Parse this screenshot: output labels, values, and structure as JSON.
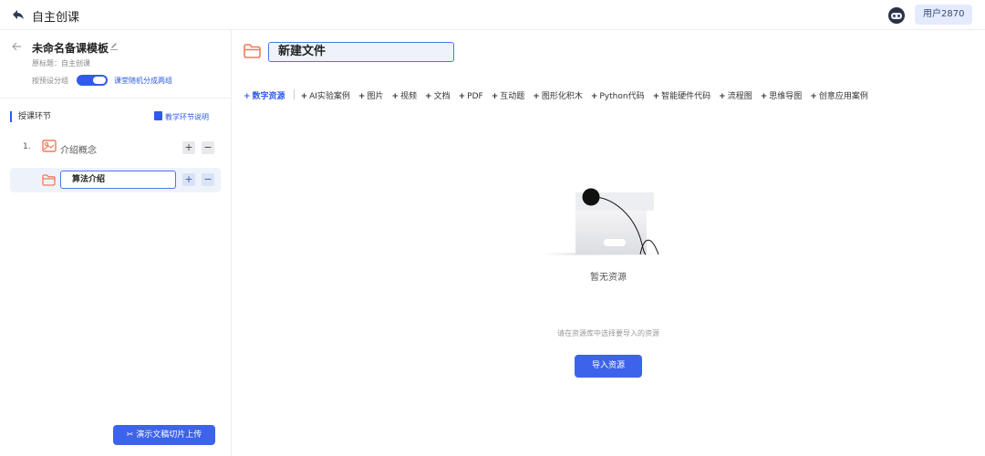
{
  "header": {
    "app_title": "自主创课",
    "user_label": "用户2870"
  },
  "sidebar": {
    "template_name": "未命名备课模板",
    "original_title": "原标题：自主创课",
    "group_label": "按预设分组",
    "group_mode": "课堂随机分成两组",
    "section_title": "授课环节",
    "section_help": "教学环节说明",
    "lessons": [
      {
        "number": "1.",
        "label": "介绍概念"
      }
    ],
    "editing_lesson_value": "算法介绍",
    "upload_button": "演示文稿切片上传"
  },
  "main": {
    "file_title": "新建文件",
    "tabs": [
      {
        "label": "数字资源",
        "active": true
      },
      {
        "label": "AI实验案例"
      },
      {
        "label": "图片"
      },
      {
        "label": "视频"
      },
      {
        "label": "文档"
      },
      {
        "label": "PDF"
      },
      {
        "label": "互动题"
      },
      {
        "label": "图形化积木"
      },
      {
        "label": "Python代码"
      },
      {
        "label": "智能硬件代码"
      },
      {
        "label": "流程图"
      },
      {
        "label": "思维导图"
      },
      {
        "label": "创意应用案例"
      }
    ],
    "tab_plus": "+",
    "empty_title": "暂无资源",
    "hint": "请在资源库中选择要导入的资源",
    "import_button": "导入资源"
  },
  "buttons": {
    "plus": "+",
    "minus": "−"
  },
  "colors": {
    "accent": "#2f5bea",
    "folder": "#f07b5a",
    "primary_button": "#3d63ea"
  },
  "icons": [
    "back-arrow-icon",
    "robot-icon",
    "edit-icon",
    "toggle-switch",
    "clipboard-icon",
    "image-icon",
    "folder-icon",
    "plus-icon",
    "minus-icon",
    "scissors-icon"
  ]
}
